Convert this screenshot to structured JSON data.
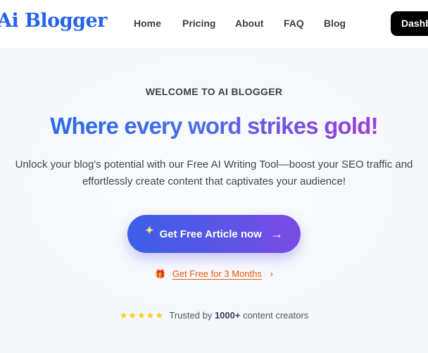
{
  "header": {
    "logo": "Ai Blogger",
    "nav": [
      "Home",
      "Pricing",
      "About",
      "FAQ",
      "Blog"
    ],
    "dashboard_label": "Dashb"
  },
  "hero": {
    "eyebrow": "WELCOME TO AI BLOGGER",
    "headline": "Where every word strikes gold!",
    "subtext_line1": "Unlock your blog's potential with our Free AI Writing Tool—boost your SEO traffic and",
    "subtext_line2": "effortlessly create content that captivates your audience!",
    "cta_label": "Get Free Article now",
    "cta_icon": "sparkle-icon",
    "cta_arrow": "arrow-right-icon",
    "promo_label": "Get Free for 3 Months",
    "promo_icon": "gift-icon",
    "trust_prefix": "Trusted by",
    "trust_count": "1000+",
    "trust_suffix": "content creators",
    "rating_stars": 5
  },
  "colors": {
    "brand": "#2563eb",
    "cta_start": "#3b5fe8",
    "cta_end": "#7c4ae6",
    "promo": "#ea580c",
    "stars": "#facc15"
  }
}
